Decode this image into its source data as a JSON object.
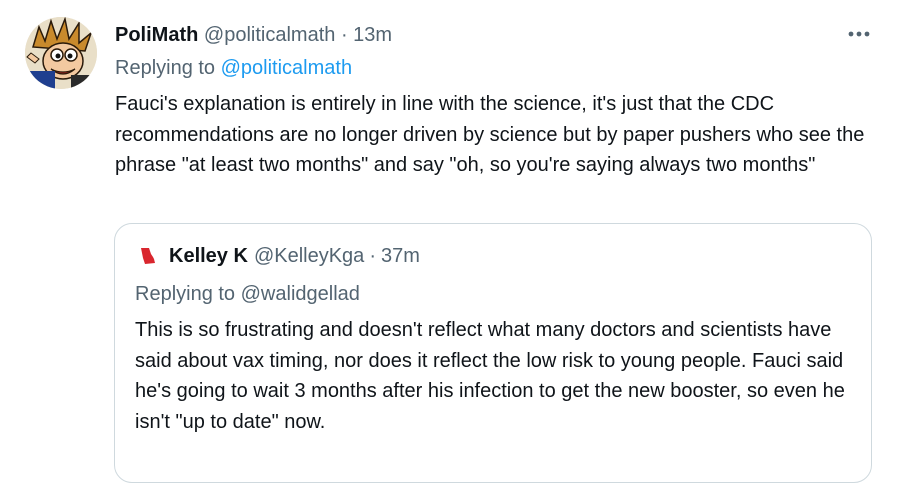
{
  "tweet": {
    "display_name": "PoliMath",
    "handle": "@politicalmath",
    "separator": "·",
    "time": "13m",
    "reply_prefix": "Replying to",
    "reply_handle": "@politicalmath",
    "text": "Fauci's explanation is entirely in line with the science, it's just that the CDC recommendations are no longer driven by science but by paper pushers who see the phrase \"at least two months\" and say \"oh, so you're saying always two months\"",
    "more_icon": "more-horizontal-icon"
  },
  "quote": {
    "display_name": "Kelley K",
    "handle": "@KelleyKga",
    "separator": "·",
    "time": "37m",
    "reply_prefix": "Replying to",
    "reply_handle": "@walidgellad",
    "text": "This is so frustrating and doesn't reflect what many doctors and scientists have said about vax timing, nor does it reflect the low risk to young people. Fauci said he's going to wait 3 months after his infection to get the new booster, so even he isn't \"up to date\" now.",
    "name_icon": "georgia-flag-icon"
  },
  "colors": {
    "text_primary": "#0f1419",
    "text_secondary": "#536471",
    "link": "#1d9bf0",
    "border": "#cfd9de"
  }
}
